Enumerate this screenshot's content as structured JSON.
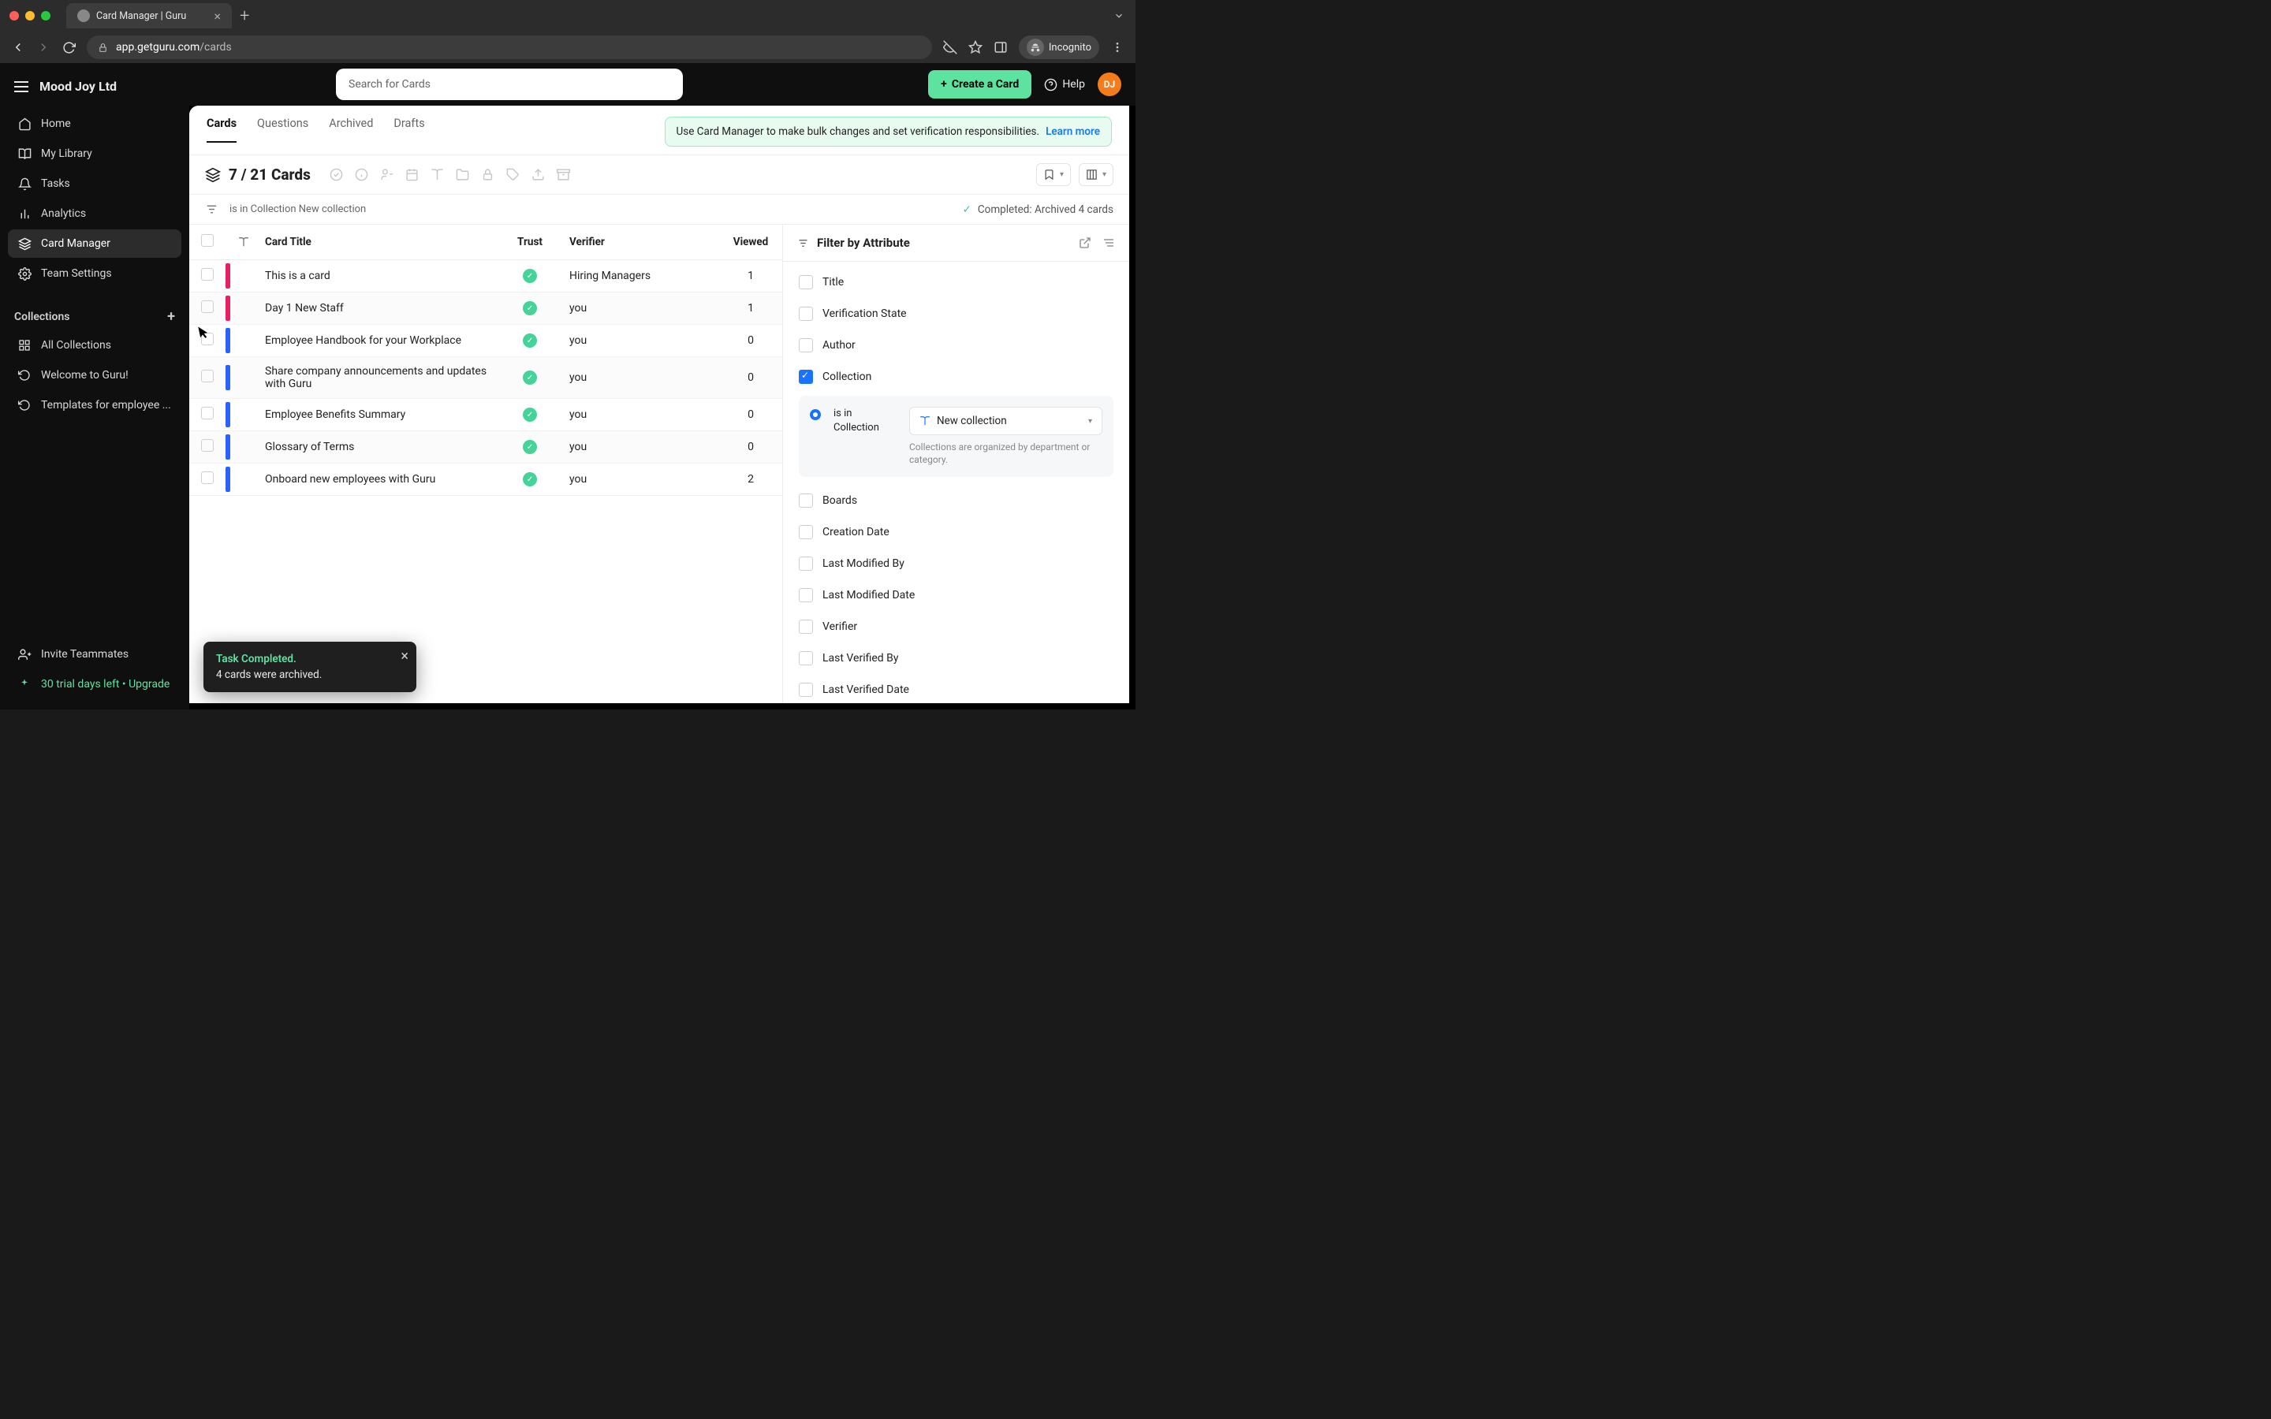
{
  "browser": {
    "tab_title": "Card Manager | Guru",
    "url_host": "app.getguru.com",
    "url_path": "/cards",
    "incognito_label": "Incognito"
  },
  "sidebar": {
    "org_name": "Mood Joy Ltd",
    "items": [
      {
        "label": "Home",
        "icon": "home"
      },
      {
        "label": "My Library",
        "icon": "book-open"
      },
      {
        "label": "Tasks",
        "icon": "bell"
      },
      {
        "label": "Analytics",
        "icon": "bar-chart"
      },
      {
        "label": "Card Manager",
        "icon": "layers"
      },
      {
        "label": "Team Settings",
        "icon": "gear"
      }
    ],
    "collections_header": "Collections",
    "collections": [
      {
        "label": "All Collections",
        "icon": "grid"
      },
      {
        "label": "Welcome to Guru!",
        "icon": "refresh"
      },
      {
        "label": "Templates for employee ...",
        "icon": "refresh"
      }
    ],
    "footer": {
      "invite": "Invite Teammates",
      "trial": "30 trial days left • Upgrade"
    }
  },
  "topbar": {
    "search_placeholder": "Search for Cards",
    "create_label": "Create a Card",
    "help_label": "Help",
    "avatar_initials": "DJ"
  },
  "banner": {
    "text": "Use Card Manager to make bulk changes and set verification responsibilities.",
    "link": "Learn more"
  },
  "tabs": [
    {
      "label": "Cards",
      "active": true
    },
    {
      "label": "Questions"
    },
    {
      "label": "Archived"
    },
    {
      "label": "Drafts"
    }
  ],
  "toolbar": {
    "count_prefix": "7 / 21",
    "count_word": "Cards"
  },
  "filter_chip": {
    "text": "is in Collection New collection",
    "completed_text": "Completed: Archived 4 cards"
  },
  "table": {
    "columns": {
      "card_title": "Card Title",
      "trust": "Trust",
      "verifier": "Verifier",
      "viewed": "Viewed"
    },
    "rows": [
      {
        "color": "#e91e63",
        "title": "This is a card",
        "verifier": "Hiring Managers",
        "viewed": "1"
      },
      {
        "color": "#e91e63",
        "title": "Day 1 New Staff",
        "verifier": "you",
        "viewed": "1"
      },
      {
        "color": "#2962ff",
        "title": "Employee Handbook for your Workplace",
        "verifier": "you",
        "viewed": "0"
      },
      {
        "color": "#2962ff",
        "title": "Share company announcements and updates with Guru",
        "verifier": "you",
        "viewed": "0"
      },
      {
        "color": "#2962ff",
        "title": "Employee Benefits Summary",
        "verifier": "you",
        "viewed": "0"
      },
      {
        "color": "#2962ff",
        "title": "Glossary of Terms",
        "verifier": "you",
        "viewed": "0"
      },
      {
        "color": "#2962ff",
        "title": "Onboard new employees with Guru",
        "verifier": "you",
        "viewed": "2"
      }
    ]
  },
  "filter_panel": {
    "title": "Filter by Attribute",
    "attributes": [
      "Title",
      "Verification State",
      "Author",
      "Collection",
      "Boards",
      "Creation Date",
      "Last Modified By",
      "Last Modified Date",
      "Verifier",
      "Last Verified By",
      "Last Verified Date"
    ],
    "collection_sub": {
      "radio_label": "is in Collection",
      "select_value": "New collection",
      "helper": "Collections are organized by department or category."
    }
  },
  "toast": {
    "title": "Task Completed.",
    "body": "4 cards were archived."
  }
}
